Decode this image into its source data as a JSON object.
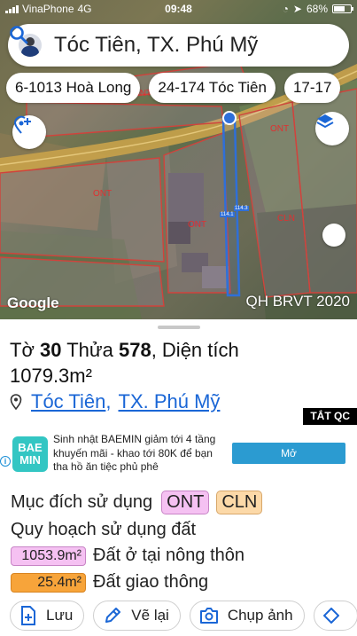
{
  "status_bar": {
    "carrier": "VinaPhone",
    "network": "4G",
    "time": "09:48",
    "battery": "68%",
    "battery_level": 0.68
  },
  "search": {
    "query": "Tóc Tiên, TX. Phú Mỹ"
  },
  "chips": [
    {
      "label": "6-1013 Hoà Long"
    },
    {
      "label": "24-174 Tóc Tiên"
    },
    {
      "label": "17-17"
    }
  ],
  "map": {
    "zone_labels": [
      "ONT",
      "ONT",
      "ONT",
      "CLN",
      "ONT"
    ],
    "length_labels": [
      "114.3",
      "114.1"
    ],
    "attribution": "Google",
    "layer_name": "QH BRVT 2020",
    "colors": {
      "parcel_border": "#d0433c",
      "selection": "#2f6fd8",
      "road": "#cfa74a"
    }
  },
  "parcel": {
    "sheet_label": "Tờ",
    "sheet_number": "30",
    "lot_label": "Thửa",
    "lot_number": "578",
    "area_label": "Diện tích",
    "area_value": "1079.3m²",
    "ward": "Tóc Tiên",
    "town": "TX. Phú Mỹ"
  },
  "ad": {
    "hide_label": "TẮT QC",
    "logo_top": "BAE",
    "logo_bottom": "MIN",
    "text": "Sinh nhật BAEMIN giảm tới 4 tầng khuyến mãi - khao tới 80K để bạn tha hồ ăn tiệc phủ phê",
    "button": "Mở",
    "info": "i"
  },
  "land_use": {
    "purpose_label": "Mục đích sử dụng",
    "purpose_tags": [
      "ONT",
      "CLN"
    ],
    "planning_label": "Quy hoạch sử dụng đất",
    "items": [
      {
        "area": "1053.9m²",
        "name": "Đất ở tại nông thôn",
        "color": "#f5c1f2"
      },
      {
        "area": "25.4m²",
        "name": "Đất giao thông",
        "color": "#f7a43a"
      }
    ]
  },
  "actions": {
    "save": "Lưu",
    "redraw": "Vẽ lại",
    "photo": "Chụp ảnh"
  }
}
